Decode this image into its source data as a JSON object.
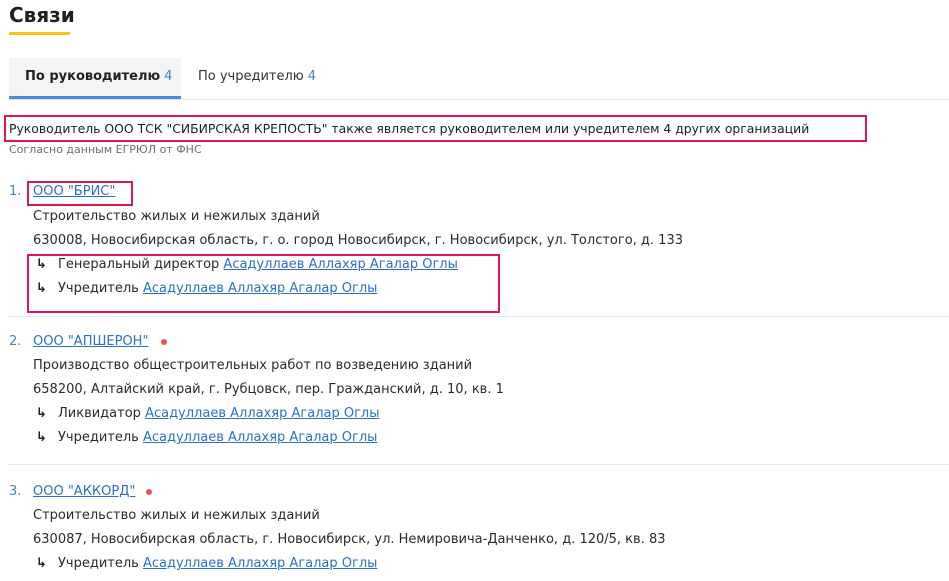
{
  "page": {
    "title": "Связи"
  },
  "tabs": [
    {
      "label": "По руководителю",
      "count": "4",
      "active": true
    },
    {
      "label": "По учредителю",
      "count": "4",
      "active": false
    }
  ],
  "summary": {
    "text": "Руководитель ООО ТСК \"СИБИРСКАЯ КРЕПОСТЬ\" также является руководителем или учредителем 4 других организаций",
    "source": "Согласно данным ЕГРЮЛ от ФНС"
  },
  "organizations": [
    {
      "number": "1.",
      "name": "ООО \"БРИС\"",
      "liquidated": false,
      "activity": "Строительство жилых и нежилых зданий",
      "address": "630008, Новосибирская область, г. о. город Новосибирск, г. Новосибирск, ул. Толстого, д. 133",
      "relations": [
        {
          "role": "Генеральный директор",
          "person": "Асадуллаев Аллахяр Агалар Оглы"
        },
        {
          "role": "Учредитель",
          "person": "Асадуллаев Аллахяр Агалар Оглы"
        }
      ]
    },
    {
      "number": "2.",
      "name": "ООО \"АПШЕРОН\"",
      "liquidated": true,
      "activity": "Производство общестроительных работ по возведению зданий",
      "address": "658200, Алтайский край, г. Рубцовск, пер. Гражданский, д. 10, кв. 1",
      "relations": [
        {
          "role": "Ликвидатор",
          "person": "Асадуллаев Аллахяр Агалар Оглы"
        },
        {
          "role": "Учредитель",
          "person": "Асадуллаев Аллахяр Агалар Оглы"
        }
      ]
    },
    {
      "number": "3.",
      "name": "ООО \"АККОРД\"",
      "liquidated": true,
      "activity": "Строительство жилых и нежилых зданий",
      "address": "630087, Новосибирская область, г. Новосибирск, ул. Немировича-Данченко, д. 120/5, кв. 83",
      "relations": [
        {
          "role": "Учредитель",
          "person": "Асадуллаев Аллахяр Агалар Оглы"
        }
      ]
    }
  ],
  "icons": {
    "relation_arrow": "↳",
    "status_dot_color": "#e2584c"
  },
  "colors": {
    "accent": "#2d6fc7",
    "highlight": "#e0174d",
    "title_underline": "#f3c623",
    "tab_indicator": "#4a8ad8"
  }
}
